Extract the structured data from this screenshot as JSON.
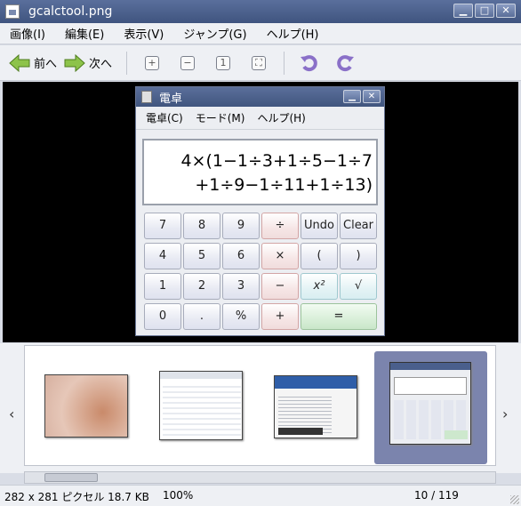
{
  "window": {
    "title": "gcalctool.png"
  },
  "menu": [
    "画像(I)",
    "編集(E)",
    "表示(V)",
    "ジャンプ(G)",
    "ヘルプ(H)"
  ],
  "toolbar": {
    "prev_label": "前へ",
    "next_label": "次へ"
  },
  "calculator": {
    "title": "電卓",
    "menu": [
      "電卓(C)",
      "モード(M)",
      "ヘルプ(H)"
    ],
    "display_line1": "4×(1−1÷3+1÷5−1÷7",
    "display_line2": "+1÷9−1÷11+1÷13)",
    "keys": {
      "k7": "7",
      "k8": "8",
      "k9": "9",
      "div": "÷",
      "undo": "Undo",
      "clear": "Clear",
      "k4": "4",
      "k5": "5",
      "k6": "6",
      "mul": "×",
      "lparen": "(",
      "rparen": ")",
      "k1": "1",
      "k2": "2",
      "k3": "3",
      "sub": "−",
      "square": "x²",
      "sqrt": "√",
      "k0": "0",
      "dot": ".",
      "pct": "%",
      "add": "+",
      "eq": "="
    }
  },
  "status": {
    "info": "282 x 281 ピクセル 18.7 KB",
    "zoom": "100%",
    "count": "10 / 119"
  },
  "colors": {
    "titlebar": "#4a5f8c",
    "selection": "#7b84ad",
    "viewport": "#000000"
  }
}
